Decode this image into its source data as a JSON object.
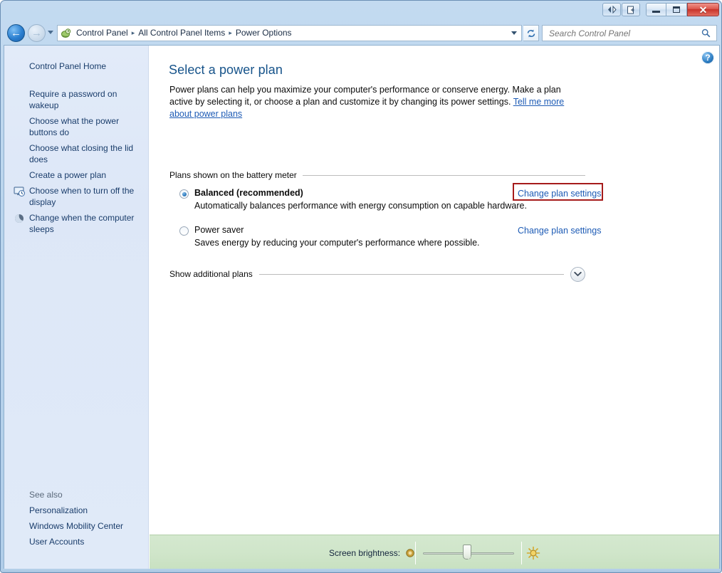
{
  "window": {
    "caption_buttons": {
      "extra": [
        {
          "name": "ie-compat-button",
          "glyph": "◁▷"
        },
        {
          "name": "page-tools-button",
          "glyph": "❐"
        }
      ],
      "minimize_label": "Minimize",
      "maximize_label": "Maximize",
      "close_label": "✕"
    }
  },
  "navbar": {
    "back_arrow": "←",
    "forward_arrow": "→",
    "breadcrumbs": [
      "Control Panel",
      "All Control Panel Items",
      "Power Options"
    ],
    "separator": "▸",
    "refresh_icon": "refresh-icon",
    "search": {
      "placeholder": "Search Control Panel",
      "value": "",
      "icon": "search-icon"
    }
  },
  "sidebar": {
    "home_label": "Control Panel Home",
    "items": [
      {
        "label": "Require a password on wakeup",
        "icon": null
      },
      {
        "label": "Choose what the power buttons do",
        "icon": null
      },
      {
        "label": "Choose what closing the lid does",
        "icon": null
      },
      {
        "label": "Create a power plan",
        "icon": null
      },
      {
        "label": "Choose when to turn off the display",
        "icon": "display-clock-icon"
      },
      {
        "label": "Change when the computer sleeps",
        "icon": "moon-sleep-icon"
      }
    ],
    "see_also": {
      "title": "See also",
      "items": [
        {
          "label": "Personalization"
        },
        {
          "label": "Windows Mobility Center"
        },
        {
          "label": "User Accounts"
        }
      ]
    }
  },
  "content": {
    "help_glyph": "?",
    "title": "Select a power plan",
    "intro_text_1": "Power plans can help you maximize your computer's performance or conserve energy. Make a plan active by selecting it, or choose a plan and customize it by changing its power settings. ",
    "intro_link": "Tell me more about power plans",
    "plans_header": "Plans shown on the battery meter",
    "plans": [
      {
        "name": "Balanced (recommended)",
        "description": "Automatically balances performance with energy consumption on capable hardware.",
        "selected": true,
        "bold": true,
        "change_link": "Change plan settings",
        "highlighted": true
      },
      {
        "name": "Power saver",
        "description": "Saves energy by reducing your computer's performance where possible.",
        "selected": false,
        "bold": false,
        "change_link": "Change plan settings",
        "highlighted": false
      }
    ],
    "show_additional_label": "Show additional plans",
    "chevron_glyph": "⌄"
  },
  "brightness": {
    "label": "Screen brightness:",
    "dim_icon": "dim-sun-icon",
    "bright_icon": "bright-sun-icon",
    "value_percent": 50
  },
  "colors": {
    "accent_link": "#1d5bb5",
    "title_text": "#16538a",
    "highlight_border": "#a61b1b",
    "brightness_bar": "#cfe5c9",
    "sidebar_bg": "#dde7f7"
  }
}
